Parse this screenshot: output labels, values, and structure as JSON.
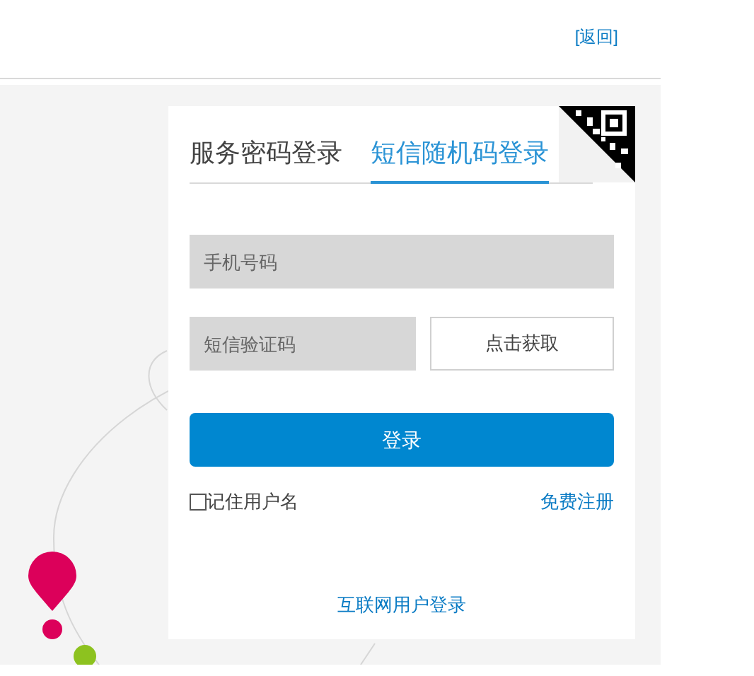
{
  "header": {
    "back_link": "[返回]"
  },
  "tabs": [
    {
      "label": "服务密码登录",
      "selected": false
    },
    {
      "label": "短信随机码登录",
      "selected": true
    }
  ],
  "phone_field": {
    "placeholder": "手机号码"
  },
  "code_field": {
    "placeholder": "短信验证码"
  },
  "get_code_button": "点击获取",
  "login_button": "登录",
  "remember": {
    "label": "记住用户名",
    "checked": false
  },
  "register_link": "免费注册",
  "internet_login_link": "互联网用户登录"
}
